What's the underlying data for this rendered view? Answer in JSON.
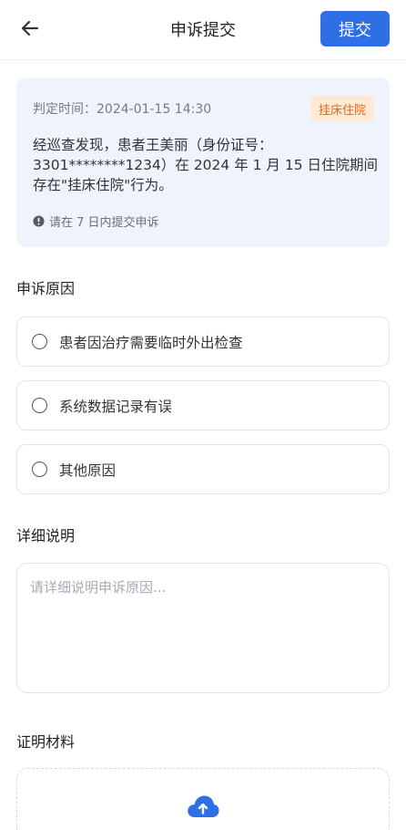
{
  "header": {
    "back_icon": "arrow-left-icon",
    "title": "申诉提交",
    "submit_label": "提交",
    "accent_color": "#2f6fe6"
  },
  "ruling": {
    "time_text": "判定时间：2024-01-15 14:30",
    "tag": "挂床住院",
    "tag_color": "#e0681a",
    "description": "经巡查发现，患者王美丽（身份证号：3301********1234）在 2024 年 1 月 15 日住院期间存在\"挂床住院\"行为。",
    "notice": "请在 7 日内提交申诉",
    "notice_icon": "info-circle-icon"
  },
  "reason": {
    "title": "申诉原因",
    "options": [
      {
        "label": "患者因治疗需要临时外出检查"
      },
      {
        "label": "系统数据记录有误"
      },
      {
        "label": "其他原因"
      }
    ]
  },
  "detail": {
    "title": "详细说明",
    "placeholder": "请详细说明申诉原因..."
  },
  "evidence": {
    "title": "证明材料",
    "upload_icon": "cloud-upload-icon"
  }
}
